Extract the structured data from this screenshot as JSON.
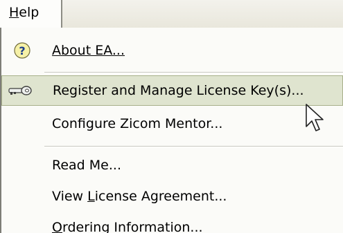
{
  "menubar": {
    "help": {
      "access_key": "H",
      "rest": "elp"
    }
  },
  "menu": {
    "about": {
      "label": "About EA...",
      "icon": "question-icon"
    },
    "register": {
      "label": "Register and Manage License Key(s)...",
      "icon": "key-icon"
    },
    "configure": {
      "label": "Configure Zicom Mentor..."
    },
    "readme": {
      "label": "Read Me..."
    },
    "license": {
      "before": "View ",
      "access_key": "L",
      "after": "icense Agreement..."
    },
    "ordering": {
      "access_key": "O",
      "rest": "rdering Information..."
    }
  },
  "colors": {
    "highlight": "#dfe4cf",
    "menu_background": "#fbfbf8"
  }
}
